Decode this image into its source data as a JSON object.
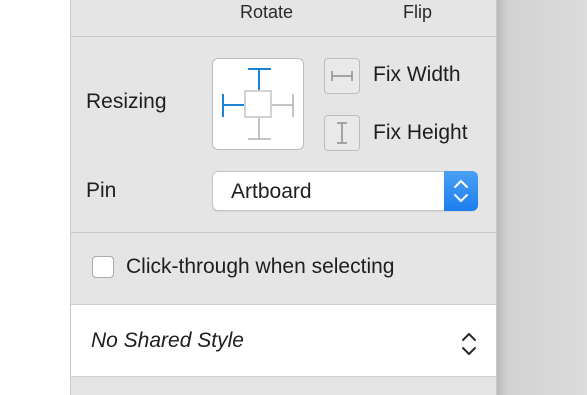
{
  "transform": {
    "rotate_label": "Rotate",
    "flip_label": "Flip"
  },
  "resizing": {
    "label": "Resizing",
    "fix_width_label": "Fix Width",
    "fix_height_label": "Fix Height"
  },
  "pin": {
    "label": "Pin",
    "value": "Artboard"
  },
  "click_through": {
    "label": "Click-through when selecting",
    "checked": false
  },
  "shared_style": {
    "value": "No Shared Style"
  },
  "colors": {
    "panel_bg": "#e5e5e5",
    "accent_blue": "#1a83d6",
    "stepper_blue": "#2b86f0",
    "icon_gray": "#8e8e8e"
  }
}
